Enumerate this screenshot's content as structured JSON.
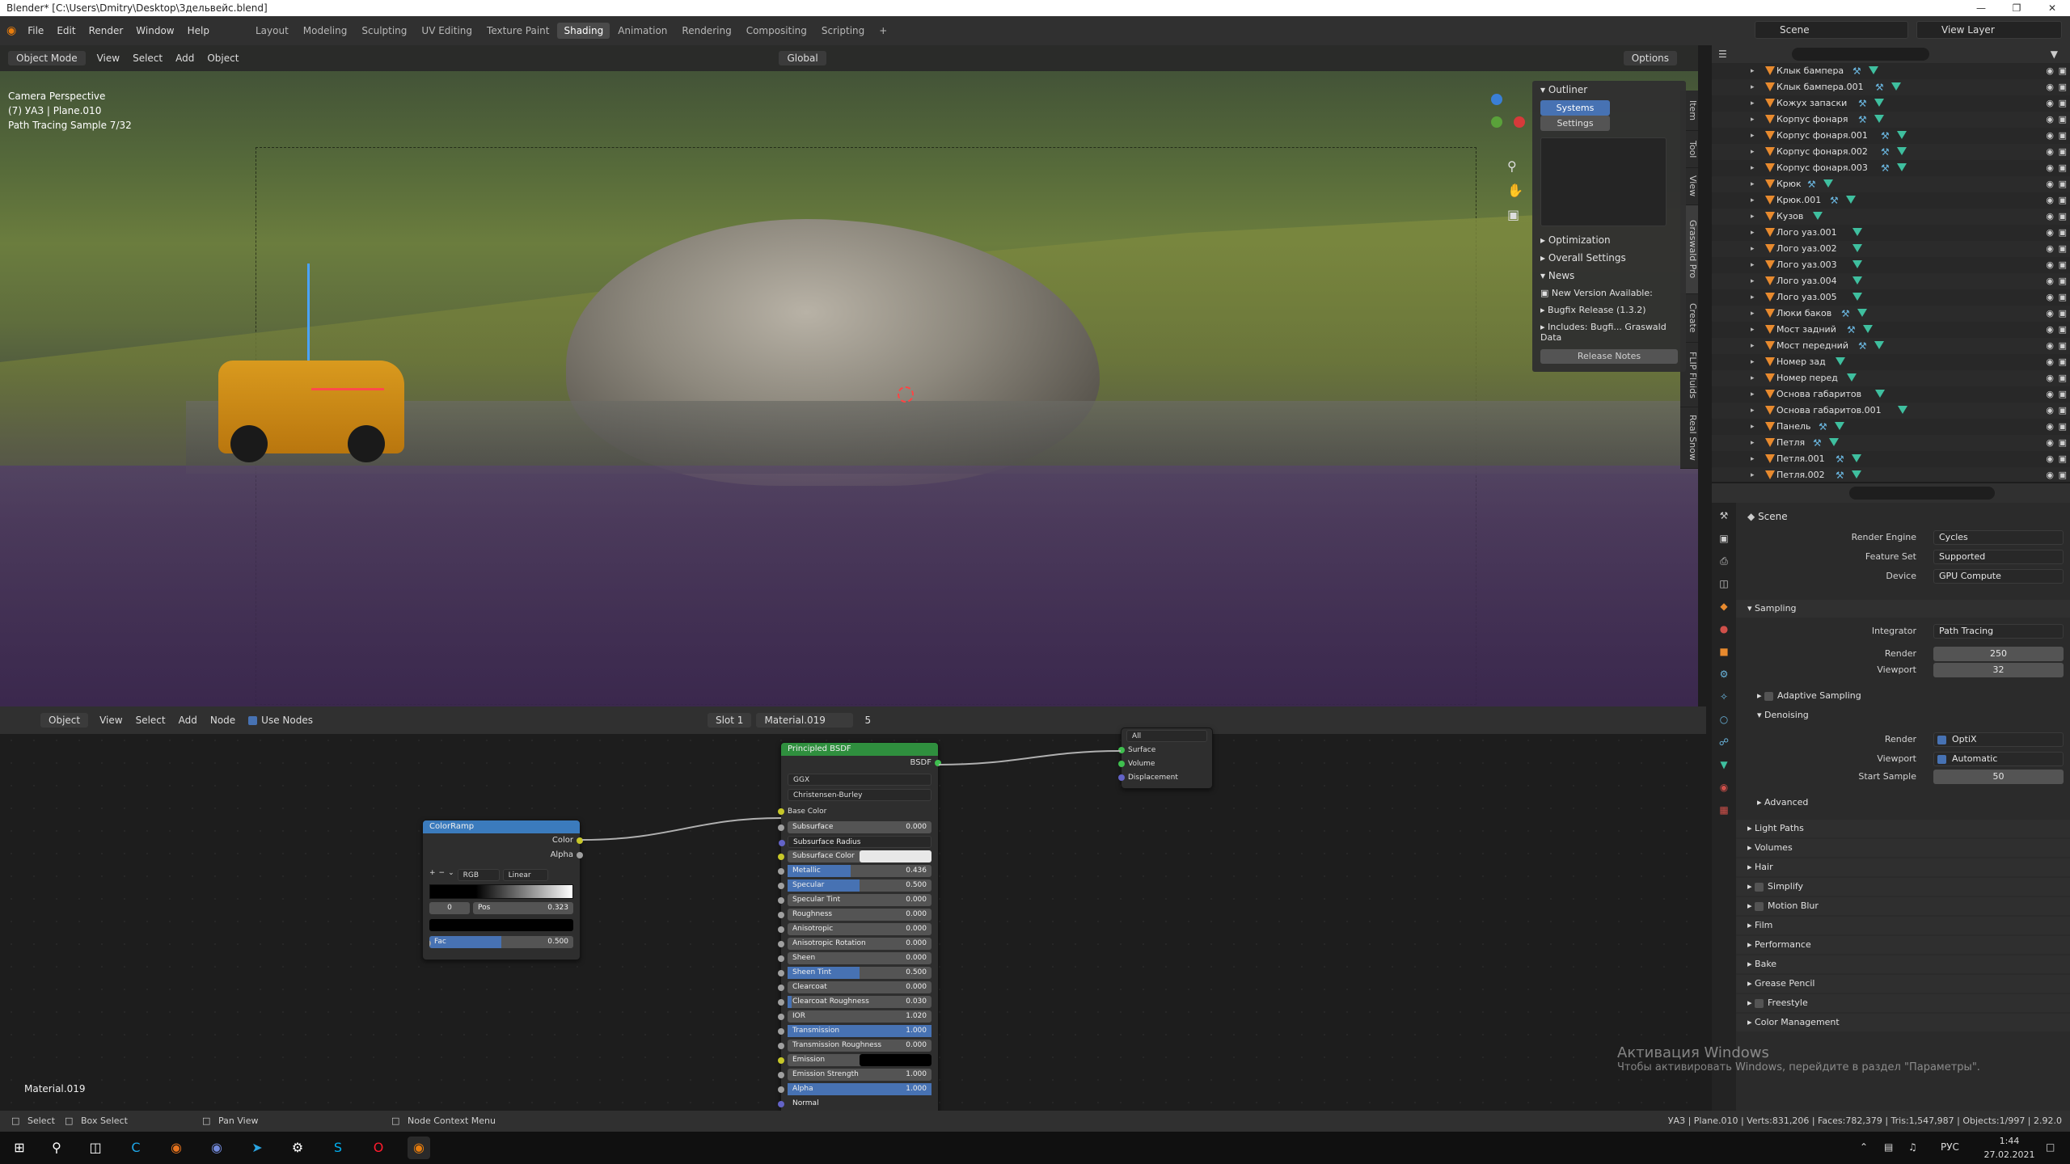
{
  "titlebar": {
    "title": "Blender* [C:\\Users\\Dmitry\\Desktop\\Здельвейс.blend]"
  },
  "menus": [
    "File",
    "Edit",
    "Render",
    "Window",
    "Help"
  ],
  "workspaces": [
    "Layout",
    "Modeling",
    "Sculpting",
    "UV Editing",
    "Texture Paint",
    "Shading",
    "Animation",
    "Rendering",
    "Compositing",
    "Scripting"
  ],
  "active_workspace": "Shading",
  "topbar": {
    "scene": "Scene",
    "view_layer": "View Layer",
    "options": "Options"
  },
  "viewport": {
    "mode": "Object Mode",
    "menu": [
      "View",
      "Select",
      "Add",
      "Object"
    ],
    "transform": "Global",
    "overlay_lines": [
      "Camera Perspective",
      "(7) УАЗ | Plane.010",
      "Path Tracing Sample 7/32"
    ],
    "side_tabs": [
      "Item",
      "Tool",
      "View",
      "Graswald Pro",
      "Create",
      "FLIP Fluids",
      "Real Snow"
    ]
  },
  "npanel": {
    "header": "Outliner",
    "tabs": [
      "Systems",
      "Settings"
    ],
    "sections": [
      "Optimization",
      "Overall Settings",
      "News"
    ],
    "news": [
      "New Version Available:",
      "Bugfix Release (1.3.2)",
      "Includes: Bugfi... Graswald Data"
    ],
    "release_button": "Release Notes"
  },
  "node_editor": {
    "object": "Object",
    "menu": [
      "View",
      "Select",
      "Add",
      "Node"
    ],
    "use_nodes": "Use Nodes",
    "slot": "Slot 1",
    "material": "Material.019",
    "users": "5",
    "material_label": "Material.019"
  },
  "colorramp": {
    "title": "ColorRamp",
    "outputs": [
      "Color",
      "Alpha"
    ],
    "mode": "RGB",
    "interp": "Linear",
    "index": "0",
    "pos_label": "Pos",
    "pos": "0.323",
    "fac_label": "Fac",
    "fac": "0.500",
    "fac_value": 0.5
  },
  "bsdf": {
    "title": "Principled BSDF",
    "output": "BSDF",
    "distribution": "GGX",
    "subsurface_method": "Christensen-Burley",
    "base_color": "Base Color",
    "rows": [
      {
        "label": "Subsurface",
        "value": "0.000",
        "fill": 0
      },
      {
        "label": "Subsurface Radius",
        "value": "",
        "fill": 0,
        "dropdown": true
      },
      {
        "label": "Subsurface Color",
        "value": "",
        "fill": 0,
        "swatch": "#e8e8e8"
      },
      {
        "label": "Metallic",
        "value": "0.436",
        "fill": 0.436
      },
      {
        "label": "Specular",
        "value": "0.500",
        "fill": 0.5
      },
      {
        "label": "Specular Tint",
        "value": "0.000",
        "fill": 0
      },
      {
        "label": "Roughness",
        "value": "0.000",
        "fill": 0
      },
      {
        "label": "Anisotropic",
        "value": "0.000",
        "fill": 0
      },
      {
        "label": "Anisotropic Rotation",
        "value": "0.000",
        "fill": 0
      },
      {
        "label": "Sheen",
        "value": "0.000",
        "fill": 0
      },
      {
        "label": "Sheen Tint",
        "value": "0.500",
        "fill": 0.5
      },
      {
        "label": "Clearcoat",
        "value": "0.000",
        "fill": 0
      },
      {
        "label": "Clearcoat Roughness",
        "value": "0.030",
        "fill": 0.03
      },
      {
        "label": "IOR",
        "value": "1.020",
        "fill": 0
      },
      {
        "label": "Transmission",
        "value": "1.000",
        "fill": 1
      },
      {
        "label": "Transmission Roughness",
        "value": "0.000",
        "fill": 0
      },
      {
        "label": "Emission",
        "value": "",
        "fill": 0,
        "swatch": "#000000"
      },
      {
        "label": "Emission Strength",
        "value": "1.000",
        "fill": 0
      },
      {
        "label": "Alpha",
        "value": "1.000",
        "fill": 1
      },
      {
        "label": "Normal",
        "value": "",
        "fill": 0,
        "plain": true
      }
    ]
  },
  "output_node": {
    "target": "All",
    "inputs": [
      "Surface",
      "Volume",
      "Displacement"
    ]
  },
  "outliner": {
    "items": [
      {
        "name": "Клык бампера",
        "mods": 2
      },
      {
        "name": "Клык бампера.001",
        "mods": 2
      },
      {
        "name": "Кожух запаски",
        "mods": 2
      },
      {
        "name": "Корпус фонаря",
        "mods": 2
      },
      {
        "name": "Корпус фонаря.001",
        "mods": 2
      },
      {
        "name": "Корпус фонаря.002",
        "mods": 2
      },
      {
        "name": "Корпус фонаря.003",
        "mods": 2
      },
      {
        "name": "Крюк",
        "mods": 2
      },
      {
        "name": "Крюк.001",
        "mods": 2
      },
      {
        "name": "Кузов",
        "mods": 1
      },
      {
        "name": "Лого уаз.001",
        "mods": 1
      },
      {
        "name": "Лого уаз.002",
        "mods": 1
      },
      {
        "name": "Лого уаз.003",
        "mods": 1
      },
      {
        "name": "Лого уаз.004",
        "mods": 1
      },
      {
        "name": "Лого уаз.005",
        "mods": 1
      },
      {
        "name": "Люки баков",
        "mods": 2
      },
      {
        "name": "Мост задний",
        "mods": 2
      },
      {
        "name": "Мост передний",
        "mods": 2
      },
      {
        "name": "Номер зад",
        "mods": 1
      },
      {
        "name": "Номер перед",
        "mods": 1
      },
      {
        "name": "Основа габаритов",
        "mods": 1
      },
      {
        "name": "Основа габаритов.001",
        "mods": 1
      },
      {
        "name": "Панель",
        "mods": 2
      },
      {
        "name": "Петля",
        "mods": 2
      },
      {
        "name": "Петля.001",
        "mods": 2
      },
      {
        "name": "Петля.002",
        "mods": 2
      }
    ]
  },
  "properties": {
    "context": "Scene",
    "render_engine_label": "Render Engine",
    "render_engine": "Cycles",
    "feature_set_label": "Feature Set",
    "feature_set": "Supported",
    "device_label": "Device",
    "device": "GPU Compute",
    "sampling": "Sampling",
    "integrator_label": "Integrator",
    "integrator": "Path Tracing",
    "render_label": "Render",
    "render": "250",
    "viewport_label": "Viewport",
    "viewport": "32",
    "adaptive": "Adaptive Sampling",
    "denoising": "Denoising",
    "denoise_render_label": "Render",
    "denoise_render": "OptiX",
    "denoise_viewport_label": "Viewport",
    "denoise_viewport": "Automatic",
    "start_sample_label": "Start Sample",
    "start_sample": "50",
    "advanced": "Advanced",
    "panels": [
      "Light Paths",
      "Volumes",
      "Hair",
      "Simplify",
      "Motion Blur",
      "Film",
      "Performance",
      "Bake",
      "Grease Pencil",
      "Freestyle",
      "Color Management"
    ]
  },
  "statusbar": {
    "left": [
      "Select",
      "Box Select",
      "Pan View",
      "Node Context Menu"
    ],
    "right": "УАЗ | Plane.010 | Verts:831,206 | Faces:782,379 | Tris:1,547,987 | Objects:1/997 | 2.92.0"
  },
  "watermark": {
    "title": "Активация Windows",
    "subtitle": "Чтобы активировать Windows, перейдите в раздел \"Параметры\"."
  },
  "taskbar": {
    "lang": "РУС",
    "time": "1:44",
    "date": "27.02.2021"
  },
  "colors": {
    "accent": "#4772b3",
    "shader_header": "#2f8f3e",
    "converter_header": "#3b7bbd",
    "object_icon": "#e88a2e"
  }
}
